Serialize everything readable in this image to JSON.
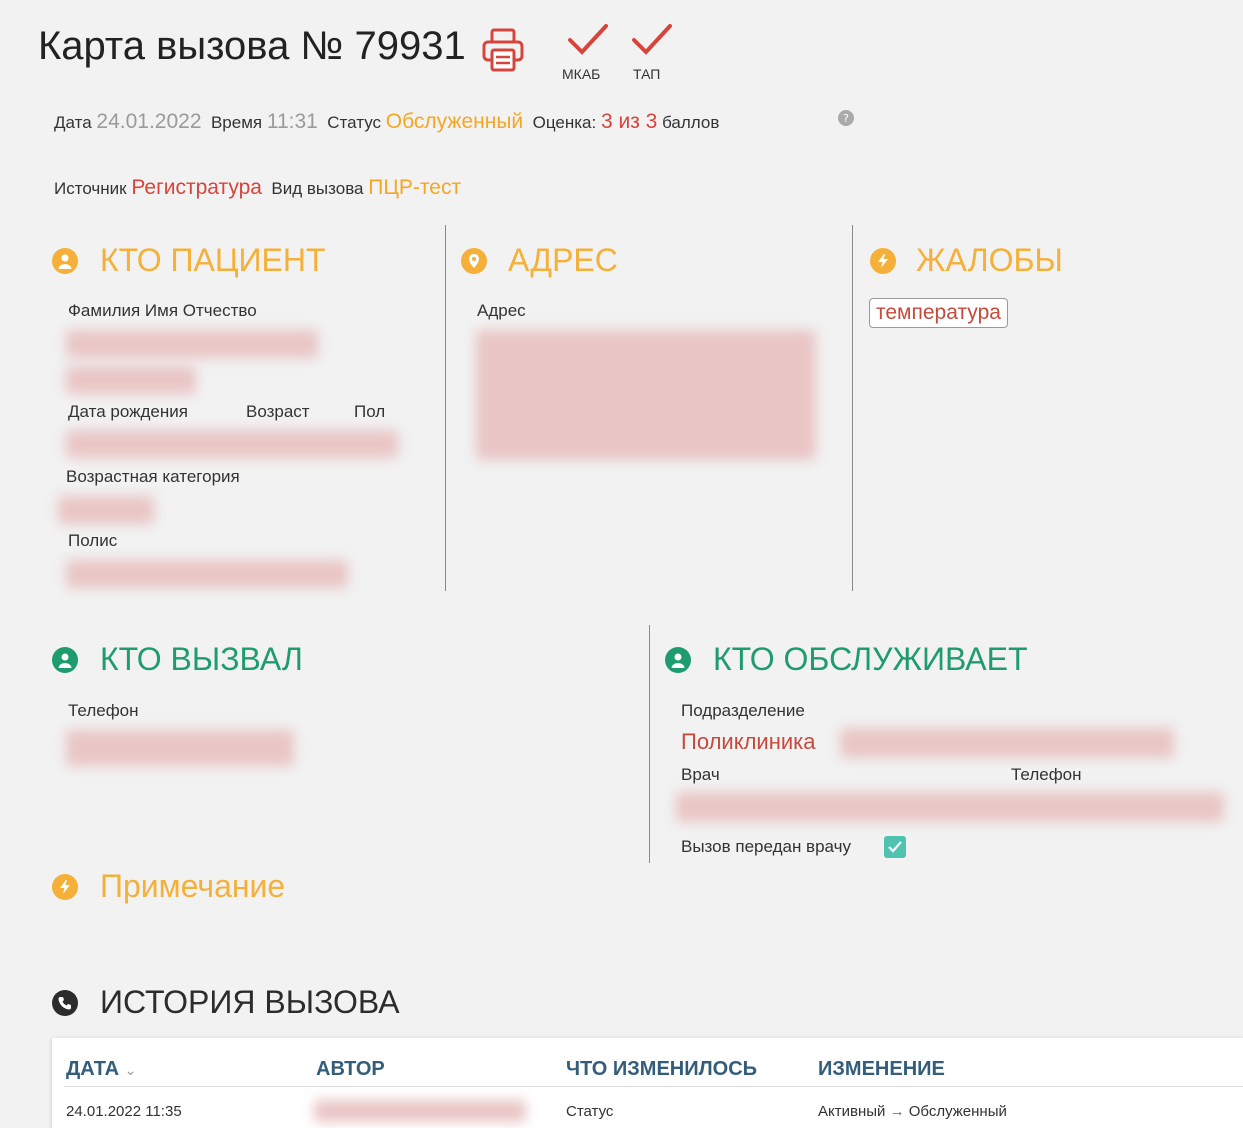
{
  "header": {
    "title": "Карта вызова № 79931",
    "print_icon": "printer-icon",
    "checks": [
      {
        "label": "МКАБ",
        "icon": "check-icon"
      },
      {
        "label": "ТАП",
        "icon": "check-icon"
      }
    ]
  },
  "meta": {
    "date_label": "Дата",
    "date_value": "24.01.2022",
    "time_label": "Время",
    "time_value": "11:31",
    "status_label": "Статус",
    "status_value": "Обслуженный",
    "rating_label": "Оценка:",
    "rating_value": "3 из 3",
    "rating_unit": "баллов",
    "source_label": "Источник",
    "source_value": "Регистратура",
    "call_type_label": "Вид вызова",
    "call_type_value": "ПЦР-тест"
  },
  "patient": {
    "heading": "КТО ПАЦИЕНТ",
    "fio_label": "Фамилия Имя Отчество",
    "dob_label": "Дата рождения",
    "age_label": "Возраст",
    "sex_label": "Пол",
    "age_category_label": "Возрастная категория",
    "policy_label": "Полис"
  },
  "address": {
    "heading": "АДРЕС",
    "address_label": "Адрес"
  },
  "complaints": {
    "heading": "ЖАЛОБЫ",
    "tags": [
      "температура"
    ]
  },
  "caller": {
    "heading": "КТО ВЫЗВАЛ",
    "phone_label": "Телефон"
  },
  "service": {
    "heading": "КТО ОБСЛУЖИВАЕТ",
    "division_label": "Подразделение",
    "division_value": "Поликлиника",
    "doctor_label": "Врач",
    "phone_label": "Телефон",
    "transferred_label": "Вызов передан врачу",
    "transferred_checked": true
  },
  "note": {
    "heading": "Примечание"
  },
  "history": {
    "heading": "ИСТОРИЯ ВЫЗОВА",
    "columns": [
      "ДАТА",
      "АВТОР",
      "ЧТО ИЗМЕНИЛОСЬ",
      "ИЗМЕНЕНИЕ"
    ],
    "sort_indicator": "⌄",
    "rows": [
      {
        "date": "24.01.2022 11:35",
        "what": "Статус",
        "from": "Активный",
        "arrow": "→",
        "to": "Обслуженный"
      }
    ]
  },
  "colors": {
    "orange": "#f5b03a",
    "green": "#1f9c6e",
    "red": "#d6453c",
    "header_blue": "#335d7a"
  }
}
